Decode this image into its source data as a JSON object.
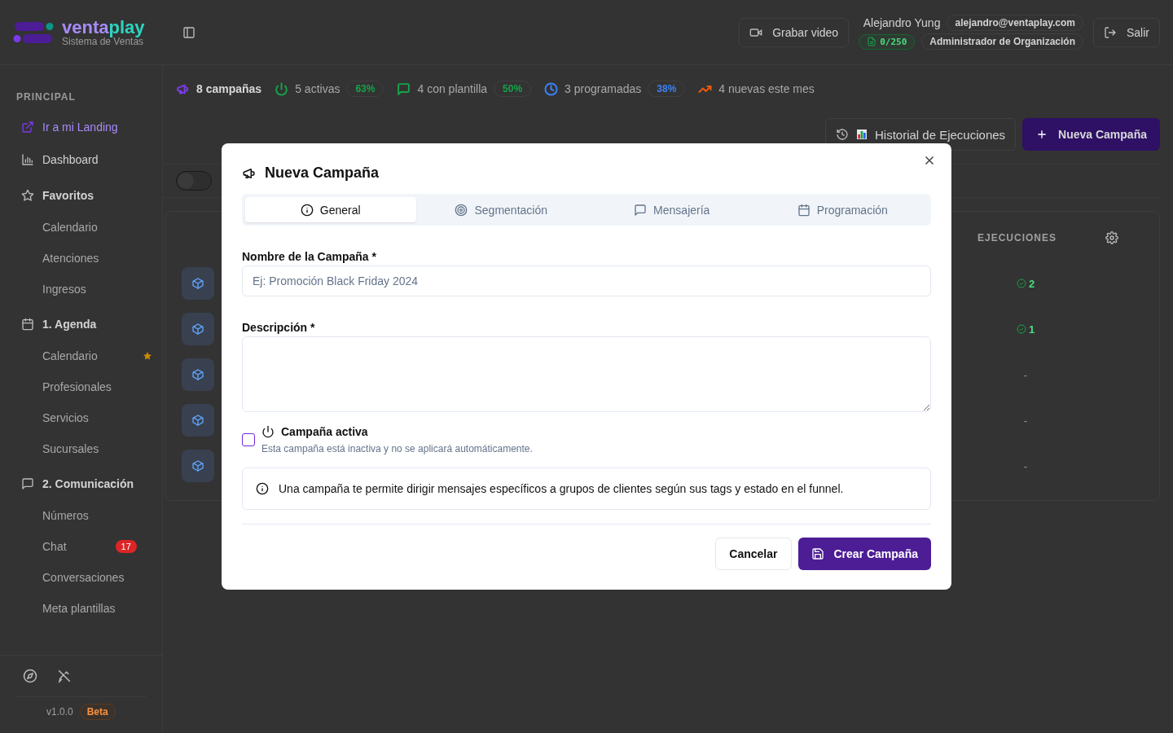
{
  "brand": {
    "name_part_1": "venta",
    "name_part_2": "play",
    "subtitle": "Sistema de Ventas"
  },
  "header": {
    "record_button": "Grabar video",
    "user_name": "Alejandro Yung",
    "user_email": "alejandro@ventaplay.com",
    "quota": "0/250",
    "role": "Administrador de Organización",
    "logout_button": "Salir"
  },
  "sidebar": {
    "section_title": "PRINCIPAL",
    "links": [
      {
        "kind": "landing",
        "label": "Ir a mi Landing"
      },
      {
        "kind": "dashboard",
        "label": "Dashboard"
      }
    ],
    "groups": [
      {
        "kind": "star",
        "label": "Favoritos",
        "children": [
          {
            "label": "Calendario",
            "favorite": false
          },
          {
            "label": "Atenciones",
            "favorite": false
          },
          {
            "label": "Ingresos",
            "favorite": false
          }
        ]
      },
      {
        "kind": "calendar",
        "label": "1. Agenda",
        "children": [
          {
            "label": "Calendario",
            "favorite": true
          },
          {
            "label": "Profesionales",
            "favorite": false
          },
          {
            "label": "Servicios",
            "favorite": false
          },
          {
            "label": "Sucursales",
            "favorite": false
          }
        ]
      },
      {
        "kind": "chat",
        "label": "2. Comunicación",
        "children": [
          {
            "label": "Números",
            "favorite": false
          },
          {
            "label": "Chat",
            "favorite": false,
            "badge": "17"
          },
          {
            "label": "Conversaciones",
            "favorite": false
          },
          {
            "label": "Meta plantillas",
            "favorite": false
          }
        ]
      }
    ],
    "version": "v1.0.0",
    "version_tag": "Beta"
  },
  "stats": [
    {
      "kind": "megaphone",
      "color": "#7c3aed",
      "label": "8 campañas"
    },
    {
      "kind": "power",
      "color": "#16a34a",
      "label": "5 activas",
      "badge": "63%"
    },
    {
      "kind": "message",
      "color": "#16a34a",
      "label": "4 con plantilla",
      "badge": "50%"
    },
    {
      "kind": "clock",
      "color": "#3b82f6",
      "label": "3 programadas",
      "badge": "38%"
    },
    {
      "kind": "trend",
      "color": "#ea580c",
      "label": "4 nuevas este mes"
    }
  ],
  "actions": {
    "history_button": "Historial de Ejecuciones",
    "new_button": "Nueva Campaña"
  },
  "filter_toggle": {
    "on": false
  },
  "table": {
    "columns": [
      "EJECUCIONES"
    ],
    "rows": [
      {
        "executions": "2",
        "done": true
      },
      {
        "executions": "1",
        "done": true
      },
      {
        "executions": "-",
        "done": false
      },
      {
        "executions": "-",
        "done": false
      },
      {
        "executions": "-",
        "done": false
      }
    ]
  },
  "dialog": {
    "title": "Nueva Campaña",
    "tabs": [
      {
        "kind": "info",
        "label": "General",
        "selected": true
      },
      {
        "kind": "target",
        "label": "Segmentación",
        "selected": false
      },
      {
        "kind": "message",
        "label": "Mensajería",
        "selected": false
      },
      {
        "kind": "calendar",
        "label": "Programación",
        "selected": false
      }
    ],
    "name_label": "Nombre de la Campaña *",
    "name_placeholder": "Ej: Promoción Black Friday 2024",
    "description_label": "Descripción *",
    "active": {
      "label": "Campaña activa",
      "checked": false,
      "hint": "Esta campaña está inactiva y no se aplicará automáticamente."
    },
    "info": "Una campaña te permite dirigir mensajes específicos a grupos de clientes según sus tags y estado en el funnel.",
    "cancel_button": "Cancelar",
    "submit_button": "Crear Campaña"
  }
}
